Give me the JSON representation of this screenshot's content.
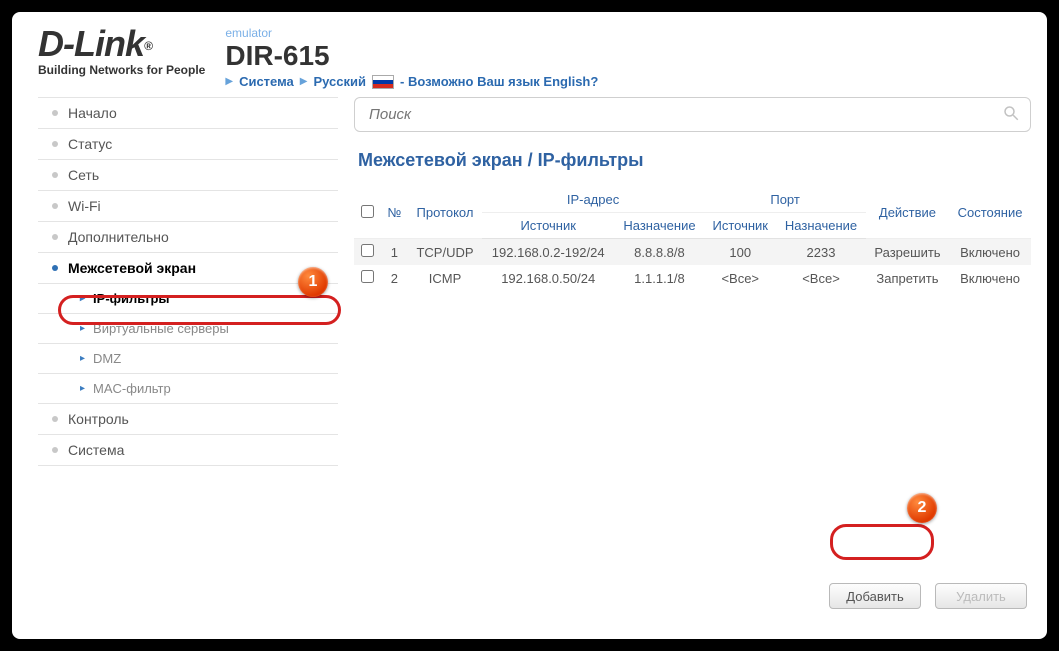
{
  "header": {
    "brand_top": "D-Link",
    "brand_sub": "Building Networks for People",
    "emulator_tag": "emulator",
    "model": "DIR-615",
    "crumb_system": "Система",
    "crumb_lang": "Русский",
    "lang_question": "- Возможно Ваш язык English?"
  },
  "search": {
    "placeholder": "Поиск"
  },
  "sidebar": {
    "items": [
      {
        "label": "Начало"
      },
      {
        "label": "Статус"
      },
      {
        "label": "Сеть"
      },
      {
        "label": "Wi-Fi"
      },
      {
        "label": "Дополнительно"
      },
      {
        "label": "Межсетевой экран",
        "expanded": true,
        "children": [
          {
            "label": "IP-фильтры",
            "active": true
          },
          {
            "label": "Виртуальные серверы"
          },
          {
            "label": "DMZ"
          },
          {
            "label": "MAC-фильтр"
          }
        ]
      },
      {
        "label": "Контроль"
      },
      {
        "label": "Система"
      }
    ]
  },
  "page": {
    "title": "Межсетевой экран /  IP-фильтры"
  },
  "table": {
    "group_ip": "IP-адрес",
    "group_port": "Порт",
    "col_no": "№",
    "col_proto": "Протокол",
    "col_src": "Источник",
    "col_dst": "Назначение",
    "col_psrc": "Источник",
    "col_pdst": "Назначение",
    "col_action": "Действие",
    "col_state": "Состояние",
    "rows": [
      {
        "no": "1",
        "proto": "TCP/UDP",
        "src": "192.168.0.2-192/24",
        "dst": "8.8.8.8/8",
        "psrc": "100",
        "pdst": "2233",
        "action": "Разрешить",
        "state": "Включено"
      },
      {
        "no": "2",
        "proto": "ICMP",
        "src": "192.168.0.50/24",
        "dst": "1.1.1.1/8",
        "psrc": "<Все>",
        "pdst": "<Все>",
        "action": "Запретить",
        "state": "Включено"
      }
    ]
  },
  "buttons": {
    "add": "Добавить",
    "delete": "Удалить"
  },
  "callouts": {
    "b1": "1",
    "b2": "2"
  }
}
